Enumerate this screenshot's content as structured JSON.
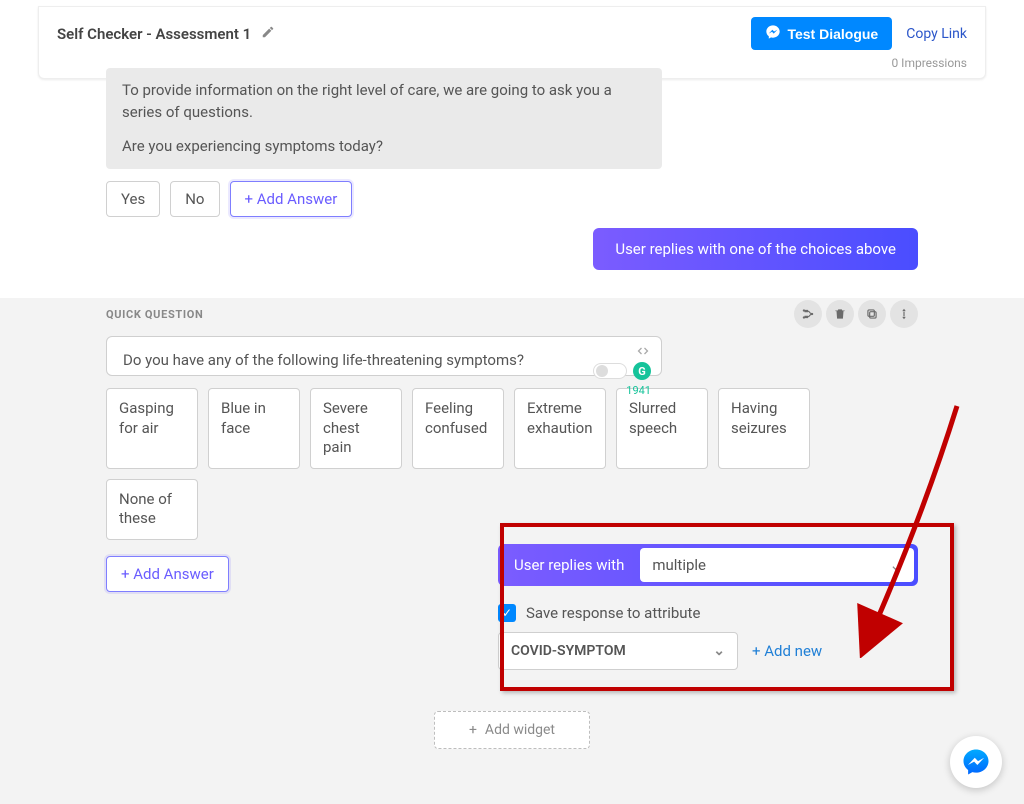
{
  "header": {
    "title": "Self Checker - Assessment 1",
    "test_button": "Test Dialogue",
    "copy_link": "Copy Link",
    "impressions": "0 Impressions"
  },
  "block1": {
    "message_line1": "To provide information on the right level of care, we are going to ask you a series of questions.",
    "message_line2": "Are you experiencing symptoms today?",
    "answers": [
      "Yes",
      "No"
    ],
    "add_answer": "+ Add Answer"
  },
  "reply_pill": "User replies with one of the choices above",
  "block2": {
    "section_label": "QUICK QUESTION",
    "question": "Do you have any of the following life-threatening symptoms?",
    "char_count": "1941",
    "answers": [
      "Gasping for air",
      "Blue in face",
      "Severe chest pain",
      "Feeling confused",
      "Extreme exhaution",
      "Slurred speech",
      "Having seizures",
      "None of these"
    ],
    "add_answer": "+ Add Answer"
  },
  "reply_config": {
    "label": "User replies with",
    "mode": "multiple",
    "save_label": "Save response to attribute",
    "attribute": "COVID-SYMPTOM",
    "add_new": "+ Add new"
  },
  "add_widget": "Add widget",
  "icons": {
    "edit": "pencil-icon",
    "messenger": "messenger-icon",
    "branch": "branch-icon",
    "trash": "trash-icon",
    "copy": "copy-icon",
    "drag": "drag-icon",
    "code": "code-icon",
    "smiley": "smiley-icon",
    "grammarly": "G",
    "plus": "+",
    "check": "✓",
    "chevron": "⌄"
  }
}
